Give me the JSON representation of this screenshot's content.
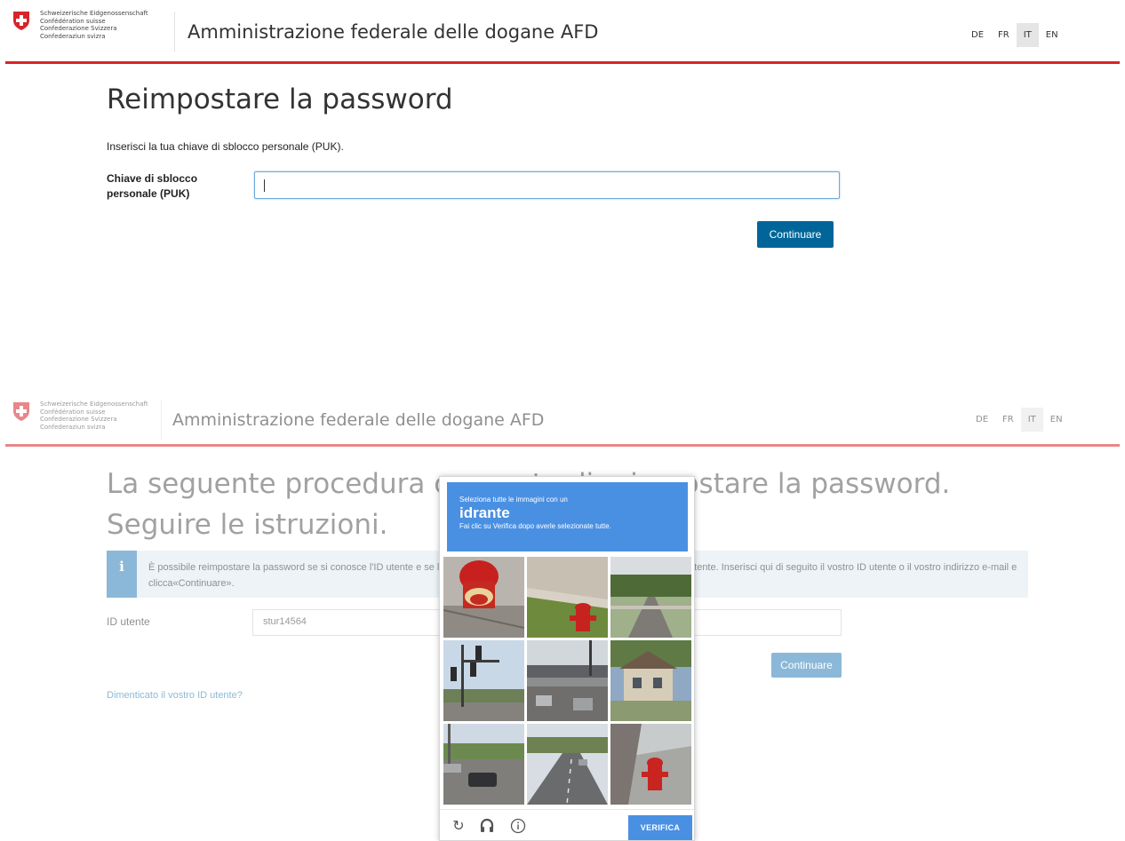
{
  "confederation": [
    "Schweizerische Eidgenossenschaft",
    "Confédération suisse",
    "Confederazione Svizzera",
    "Confederaziun svizra"
  ],
  "app_title": "Amministrazione federale delle dogane AFD",
  "languages": [
    {
      "code": "DE",
      "active": false
    },
    {
      "code": "FR",
      "active": false
    },
    {
      "code": "IT",
      "active": true
    },
    {
      "code": "EN",
      "active": false
    }
  ],
  "colors": {
    "brand_red": "#d8232a",
    "primary_blue": "#006699",
    "captcha_blue": "#4a90e2"
  },
  "reset_page": {
    "title": "Reimpostare la password",
    "intro": "Inserisci la tua chiave di sblocco personale (PUK).",
    "puk_label_line1": "Chiave di sblocco",
    "puk_label_line2": "personale (PUK)",
    "puk_value": "",
    "continue_label": "Continuare"
  },
  "procedure_page": {
    "title": "La seguente procedura consente di reimpostare la password. Seguire le istruzioni.",
    "info_text": "È possibile reimpostare la password se si conosce l'ID utente e se le impostazioni di sicurezza lo consentono per gli account utente. Inserisci qui di seguito il vostro ID utente o il vostro indirizzo e-mail e clicca«Continuare».",
    "user_id_label": "ID utente",
    "user_id_value": "stur14564",
    "continue_label": "Continuare",
    "forgot_link": "Dimenticato il vostro ID utente?"
  },
  "captcha": {
    "instruction": "Seleziona tutte le immagini con un",
    "object": "idrante",
    "subtext": "Fai clic su Verifica dopo averle selezionate tutte.",
    "tiles": [
      {
        "scene": "hydrant close-up",
        "icon": "hydrant-image"
      },
      {
        "scene": "hydrant on grass",
        "icon": "hydrant-image"
      },
      {
        "scene": "suburban street",
        "icon": "street-image"
      },
      {
        "scene": "traffic lights",
        "icon": "traffic-light-image"
      },
      {
        "scene": "overpass road",
        "icon": "road-image"
      },
      {
        "scene": "house",
        "icon": "house-image"
      },
      {
        "scene": "cars on road",
        "icon": "road-image"
      },
      {
        "scene": "highway",
        "icon": "road-image"
      },
      {
        "scene": "hydrant on sidewalk",
        "icon": "hydrant-image"
      }
    ],
    "verify_label": "VERIFICA",
    "footer_icons": [
      "reload-icon",
      "audio-icon",
      "info-icon"
    ]
  }
}
